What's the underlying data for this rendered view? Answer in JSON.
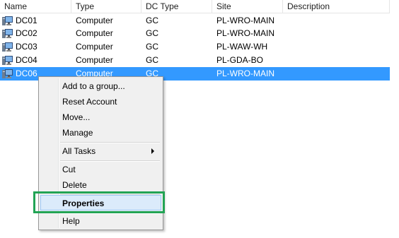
{
  "columns": {
    "name": "Name",
    "type": "Type",
    "dc_type": "DC Type",
    "site": "Site",
    "description": "Description"
  },
  "rows": [
    {
      "name": "DC01",
      "type": "Computer",
      "dc_type": "GC",
      "site": "PL-WRO-MAIN",
      "icon": "computer-icon"
    },
    {
      "name": "DC02",
      "type": "Computer",
      "dc_type": "GC",
      "site": "PL-WRO-MAIN",
      "icon": "computer-icon"
    },
    {
      "name": "DC03",
      "type": "Computer",
      "dc_type": "GC",
      "site": "PL-WAW-WH",
      "icon": "computer-icon"
    },
    {
      "name": "DC04",
      "type": "Computer",
      "dc_type": "GC",
      "site": "PL-GDA-BO",
      "icon": "computer-icon"
    },
    {
      "name": "DC06",
      "type": "Computer",
      "dc_type": "GC",
      "site": "PL-WRO-MAIN",
      "icon": "computer-icon",
      "selected": true
    }
  ],
  "context_menu": {
    "items": [
      {
        "label": "Add to a group..."
      },
      {
        "label": "Reset Account"
      },
      {
        "label": "Move..."
      },
      {
        "label": "Manage"
      },
      {
        "label": "All Tasks",
        "submenu": true
      },
      {
        "label": "Cut"
      },
      {
        "label": "Delete"
      },
      {
        "label": "Properties",
        "default": true,
        "highlighted": true
      },
      {
        "label": "Help"
      }
    ]
  },
  "colors": {
    "selection": "#3399ff",
    "menu_highlight": "#dbebfb",
    "annotation_box": "#22a455"
  }
}
